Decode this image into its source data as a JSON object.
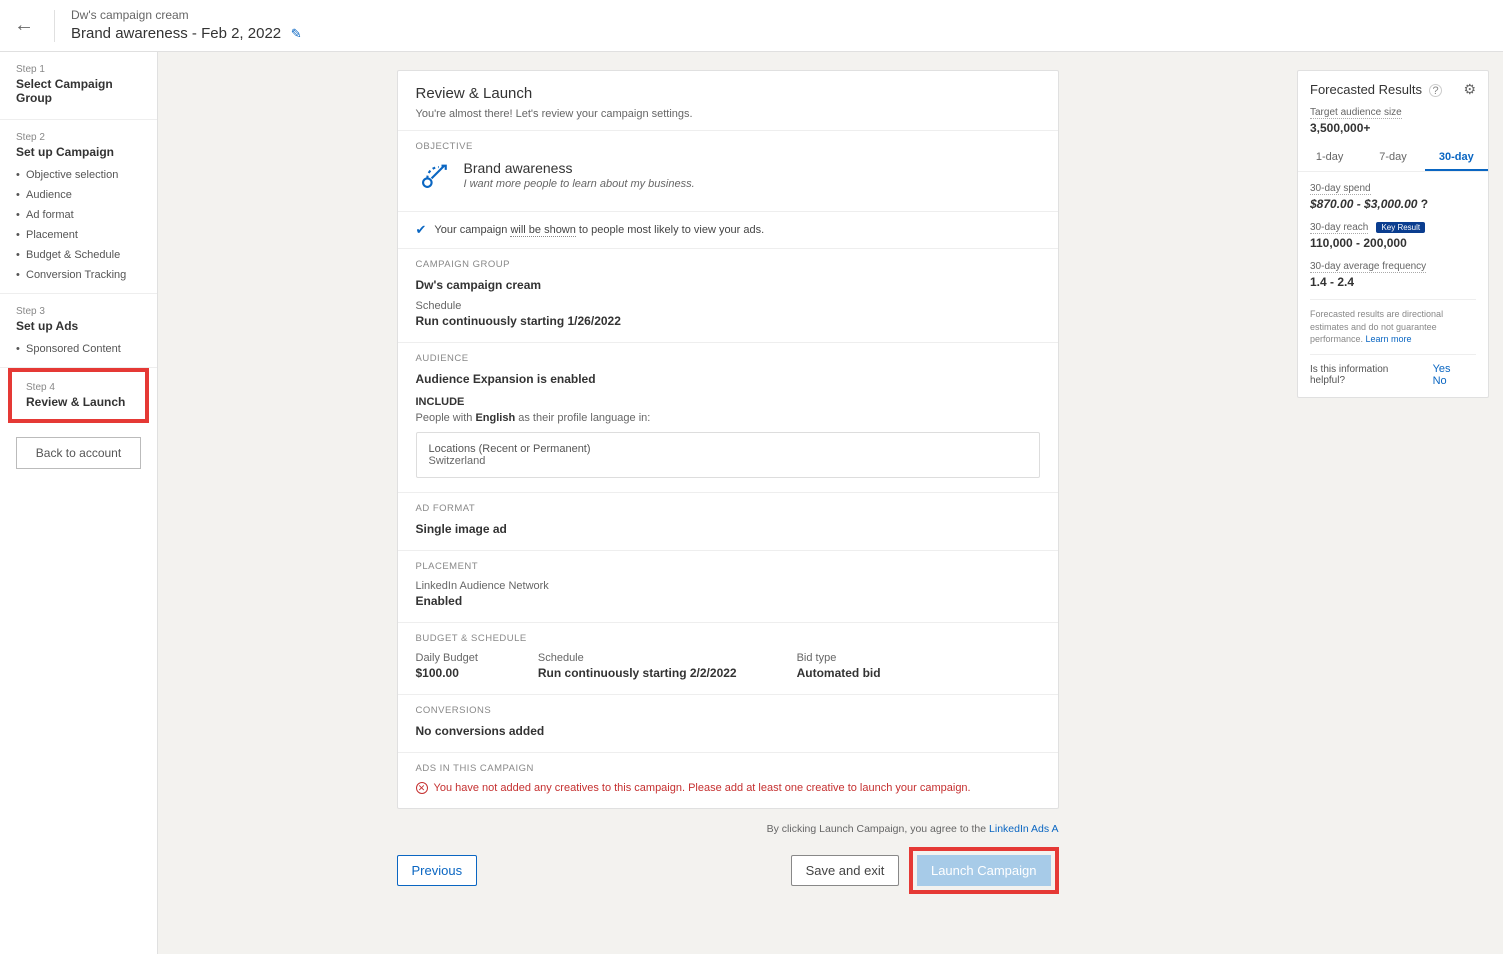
{
  "header": {
    "subtitle": "Dw's campaign cream",
    "title": "Brand awareness - Feb 2, 2022"
  },
  "sidebar": {
    "step1": {
      "num": "Step 1",
      "title": "Select Campaign Group"
    },
    "step2": {
      "num": "Step 2",
      "title": "Set up Campaign",
      "items": [
        "Objective selection",
        "Audience",
        "Ad format",
        "Placement",
        "Budget & Schedule",
        "Conversion Tracking"
      ]
    },
    "step3": {
      "num": "Step 3",
      "title": "Set up Ads",
      "items": [
        "Sponsored Content"
      ]
    },
    "step4": {
      "num": "Step 4",
      "title": "Review & Launch"
    },
    "back": "Back to account"
  },
  "review": {
    "title": "Review & Launch",
    "intro": "You're almost there! Let's review your campaign settings.",
    "objective": {
      "label": "OBJECTIVE",
      "name": "Brand awareness",
      "desc": "I want more people to learn about my business."
    },
    "infostrip": {
      "pre": "Your campaign ",
      "mid": "will be shown",
      "post": " to people most likely to view your ads."
    },
    "group": {
      "label": "CAMPAIGN GROUP",
      "name": "Dw's campaign cream",
      "schedLabel": "Schedule",
      "schedVal": "Run continuously starting 1/26/2022"
    },
    "audience": {
      "label": "AUDIENCE",
      "expansion": "Audience Expansion is enabled",
      "includeLabel": "INCLUDE",
      "langPre": "People with ",
      "langVal": "English",
      "langPost": " as their profile language in:",
      "locLabel": "Locations (Recent or Permanent)",
      "locVal": "Switzerland"
    },
    "adformat": {
      "label": "AD FORMAT",
      "val": "Single image ad"
    },
    "placement": {
      "label": "PLACEMENT",
      "net": "LinkedIn Audience Network",
      "status": "Enabled"
    },
    "budget": {
      "label": "BUDGET & SCHEDULE",
      "dailyLabel": "Daily Budget",
      "dailyVal": "$100.00",
      "schedLabel": "Schedule",
      "schedVal": "Run continuously starting 2/2/2022",
      "bidLabel": "Bid type",
      "bidVal": "Automated bid"
    },
    "conversions": {
      "label": "CONVERSIONS",
      "val": "No conversions added"
    },
    "ads": {
      "label": "ADS IN THIS CAMPAIGN",
      "error": "You have not added any creatives to this campaign. Please add at least one creative to launch your campaign."
    }
  },
  "footer": {
    "agreePre": "By clicking Launch Campaign, you agree to the ",
    "agreeLink": "LinkedIn Ads A",
    "previous": "Previous",
    "save": "Save and exit",
    "launch": "Launch Campaign"
  },
  "forecast": {
    "title": "Forecasted Results",
    "targetLabel": "Target audience size",
    "targetVal": "3,500,000+",
    "tabs": [
      "1-day",
      "7-day",
      "30-day"
    ],
    "activeTab": 2,
    "spendLabel": "30-day spend",
    "spendVal": "$870.00 - $3,000.00",
    "reachLabel": "30-day reach",
    "reachBadge": "Key Result",
    "reachVal": "110,000 - 200,000",
    "freqLabel": "30-day average frequency",
    "freqVal": "1.4 - 2.4",
    "disclaimer": "Forecasted results are directional estimates and do not guarantee performance. ",
    "learn": "Learn more",
    "helpful": "Is this information helpful?",
    "yes": "Yes",
    "no": "No"
  }
}
